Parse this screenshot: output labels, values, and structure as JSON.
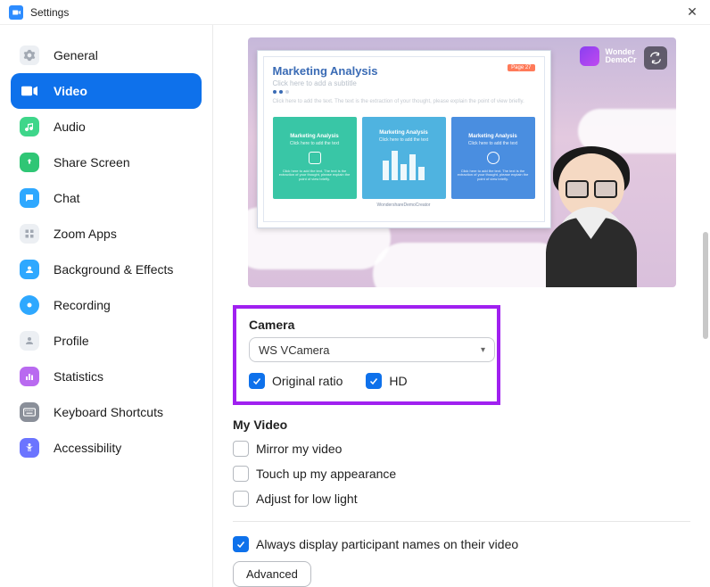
{
  "window": {
    "title": "Settings"
  },
  "sidebar": {
    "items": [
      {
        "label": "General"
      },
      {
        "label": "Video"
      },
      {
        "label": "Audio"
      },
      {
        "label": "Share Screen"
      },
      {
        "label": "Chat"
      },
      {
        "label": "Zoom Apps"
      },
      {
        "label": "Background & Effects"
      },
      {
        "label": "Recording"
      },
      {
        "label": "Profile"
      },
      {
        "label": "Statistics"
      },
      {
        "label": "Keyboard Shortcuts"
      },
      {
        "label": "Accessibility"
      }
    ]
  },
  "preview": {
    "brand1": "Wonder",
    "brand2": "DemoCr",
    "slide": {
      "title": "Marketing Analysis",
      "subtitle": "Click here to add a subtitle",
      "desc": "Click here to add the text. The text is the extraction of your thought, please explain the point of view briefly.",
      "page_badge": "Page 27",
      "cards": [
        {
          "title": "Marketing Analysis",
          "sub": "Click here to add the text"
        },
        {
          "title": "Marketing Analysis",
          "sub": "Click here to add the text"
        },
        {
          "title": "Marketing Analysis",
          "sub": "Click here to add the text"
        }
      ],
      "footer": "WondershareDemoCreator"
    }
  },
  "camera": {
    "section_label": "Camera",
    "selected": "WS VCamera",
    "original_ratio_label": "Original ratio",
    "hd_label": "HD"
  },
  "my_video": {
    "section_label": "My Video",
    "mirror_label": "Mirror my video",
    "touchup_label": "Touch up my appearance",
    "lowlight_label": "Adjust for low light"
  },
  "participant_names_label": "Always display participant names on their video",
  "advanced_label": "Advanced"
}
